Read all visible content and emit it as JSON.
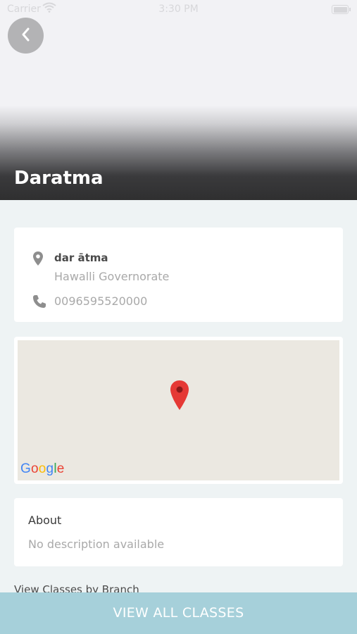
{
  "status_bar": {
    "carrier": "Carrier",
    "time": "3:30 PM"
  },
  "header": {
    "title": "Daratma"
  },
  "info": {
    "name": "dar ātma",
    "address": "Hawalli Governorate",
    "phone": "0096595520000"
  },
  "map": {
    "provider_label": "Google"
  },
  "about": {
    "title": "About",
    "description": "No description available"
  },
  "branch_link": "View Classes by Branch",
  "bottom_button": "VIEW ALL CLASSES",
  "colors": {
    "accent": "#a6d0da",
    "map_pin": "#e53935",
    "background": "#eef3f4"
  }
}
